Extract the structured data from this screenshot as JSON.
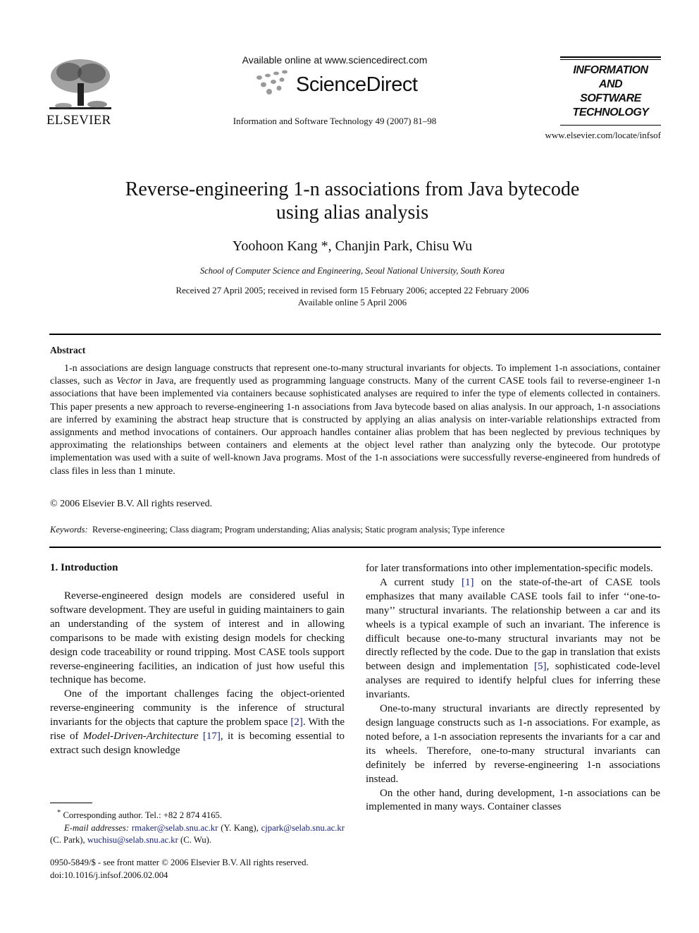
{
  "header": {
    "publisher": "ELSEVIER",
    "available_online": "Available online at www.sciencedirect.com",
    "sciencedirect": "ScienceDirect",
    "journal_ref": "Information and Software Technology 49 (2007) 81–98",
    "journal_logo_lines": [
      "INFORMATION",
      "AND",
      "SOFTWARE",
      "TECHNOLOGY"
    ],
    "journal_url": "www.elsevier.com/locate/infsof"
  },
  "article": {
    "title_line1": "Reverse-engineering 1-n associations from Java bytecode",
    "title_line2": "using alias analysis",
    "authors": "Yoohoon Kang *, Chanjin Park, Chisu Wu",
    "affiliation": "School of Computer Science and Engineering, Seoul National University, South Korea",
    "received": "Received 27 April 2005; received in revised form 15 February 2006; accepted 22 February 2006",
    "available": "Available online 5 April 2006"
  },
  "abstract": {
    "heading": "Abstract",
    "text_before_italic": "1-n associations are design language constructs that represent one-to-many structural invariants for objects. To implement 1-n associations, container classes, such as ",
    "italic": "Vector",
    "text_after_italic": " in Java, are frequently used as programming language constructs. Many of the current CASE tools fail to reverse-engineer 1-n associations that have been implemented via containers because sophisticated analyses are required to infer the type of elements collected in containers. This paper presents a new approach to reverse-engineering 1-n associations from Java bytecode based on alias analysis. In our approach, 1-n associations are inferred by examining the abstract heap structure that is constructed by applying an alias analysis on inter-variable relationships extracted from assignments and method invocations of containers. Our approach handles container alias problem that has been neglected by previous techniques by approximating the relationships between containers and elements at the object level rather than analyzing only the bytecode. Our prototype implementation was used with a suite of well-known Java programs. Most of the 1-n associations were successfully reverse-engineered from hundreds of class files in less than 1 minute.",
    "copyright": "© 2006 Elsevier B.V. All rights reserved."
  },
  "keywords": {
    "label": "Keywords:",
    "text": "Reverse-engineering; Class diagram; Program understanding; Alias analysis; Static program analysis; Type inference"
  },
  "intro": {
    "heading": "1. Introduction",
    "left_p1": "Reverse-engineered design models are considered useful in software development. They are useful in guiding maintainers to gain an understanding of the system of interest and in allowing comparisons to be made with existing design models for checking design code traceability or round tripping. Most CASE tools support reverse-engineering facilities, an indication of just how useful this technique has become.",
    "left_p2_a": "One of the important challenges facing the object-oriented reverse-engineering community is the inference of structural invariants for the objects that capture the problem space ",
    "left_p2_ref1": "[2]",
    "left_p2_b": ". With the rise of ",
    "left_p2_italic": "Model-Driven-Architecture",
    "left_p2_c": " ",
    "left_p2_ref2": "[17]",
    "left_p2_d": ", it is becoming essential to extract such design knowledge",
    "right_p0": "for later transformations into other implementation-specific models.",
    "right_p1_a": "A current study ",
    "right_p1_ref": "[1]",
    "right_p1_b": " on the state-of-the-art of CASE tools emphasizes that many available CASE tools fail to infer ‘‘one-to-many’’ structural invariants. The relationship between a car and its wheels is a typical example of such an invariant. The inference is difficult because one-to-many structural invariants may not be directly reflected by the code. Due to the gap in translation that exists between design and implementation ",
    "right_p1_ref2": "[5]",
    "right_p1_c": ", sophisticated code-level analyses are required to identify helpful clues for inferring these invariants.",
    "right_p2": "One-to-many structural invariants are directly represented by design language constructs such as 1-n associations. For example, as noted before, a 1-n association represents the invariants for a car and its wheels. Therefore, one-to-many structural invariants can definitely be inferred by reverse-engineering 1-n associations instead.",
    "right_p3": "On the other hand, during development, 1-n associations can be implemented in many ways. Container classes"
  },
  "footnotes": {
    "star": "*",
    "corresponding": "Corresponding author. Tel.: +82 2 874 4165.",
    "email_label": "E-mail addresses:",
    "email1": "rmaker@selab.snu.ac.kr",
    "email1_who": " (Y. Kang), ",
    "email2": "cjpark@selab.snu.ac.kr",
    "email2_who": " (C. Park), ",
    "email3": "wuchisu@selab.snu.ac.kr",
    "email3_who": " (C. Wu)."
  },
  "front_matter": {
    "issn": "0950-5849/$ - see front matter © 2006 Elsevier B.V. All rights reserved.",
    "doi": "doi:10.1016/j.infsof.2006.02.004"
  }
}
